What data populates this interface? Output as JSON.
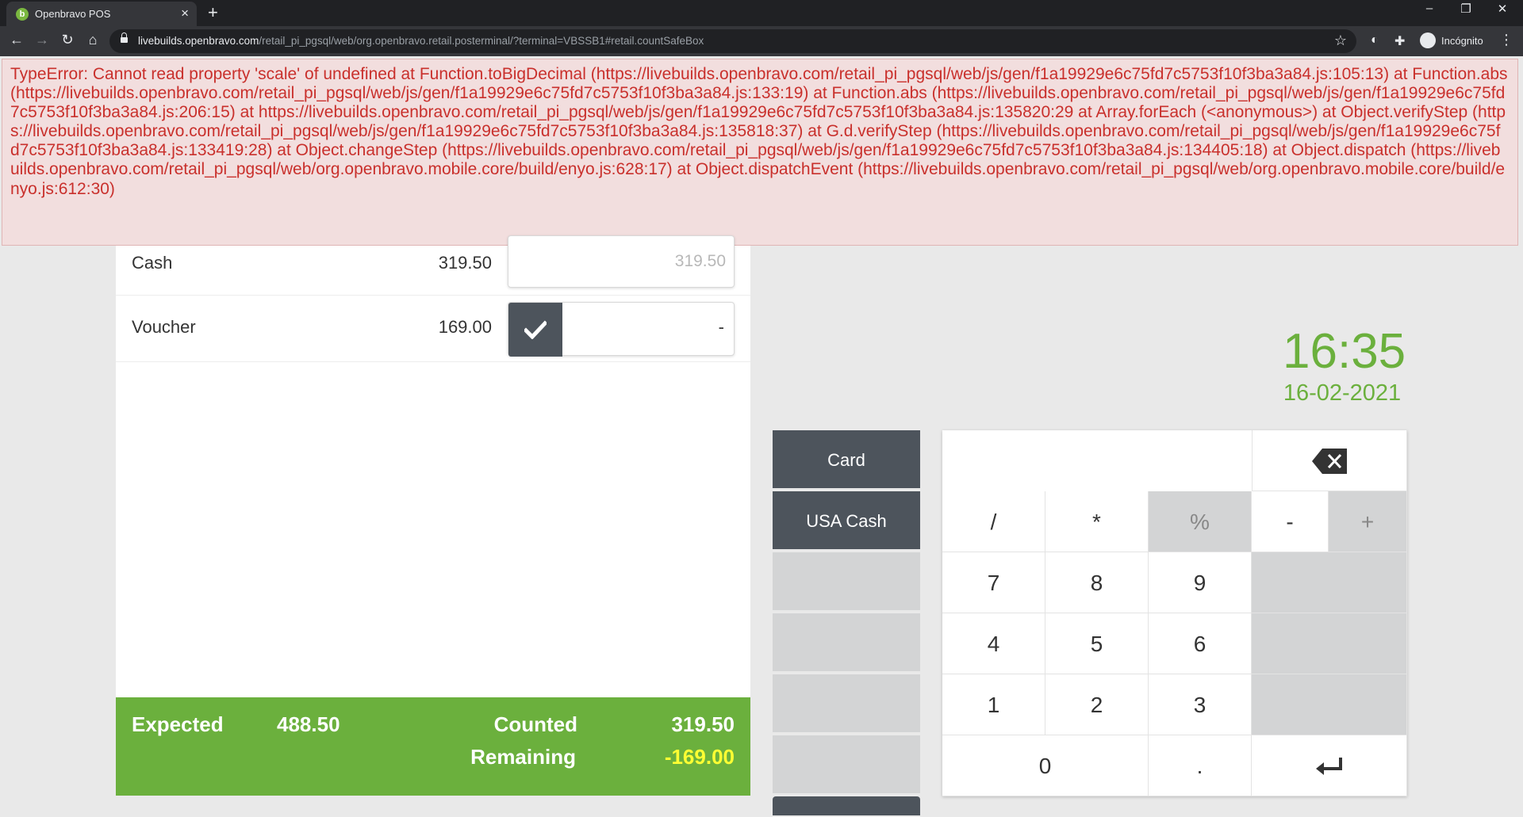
{
  "browser": {
    "tab_title": "Openbravo POS",
    "tab_favicon": "b",
    "new_tab": "+",
    "url_host": "livebuilds.openbravo.com",
    "url_path": "/retail_pi_pgsql/web/org.openbravo.retail.posterminal/?terminal=VBSSB1#retail.countSafeBox",
    "profile_label": "Incógnito"
  },
  "error": {
    "message": "TypeError: Cannot read property 'scale' of undefined at Function.toBigDecimal (https://livebuilds.openbravo.com/retail_pi_pgsql/web/js/gen/f1a19929e6c75fd7c5753f10f3ba3a84.js:105:13) at Function.abs (https://livebuilds.openbravo.com/retail_pi_pgsql/web/js/gen/f1a19929e6c75fd7c5753f10f3ba3a84.js:133:19) at Function.abs (https://livebuilds.openbravo.com/retail_pi_pgsql/web/js/gen/f1a19929e6c75fd7c5753f10f3ba3a84.js:206:15) at https://livebuilds.openbravo.com/retail_pi_pgsql/web/js/gen/f1a19929e6c75fd7c5753f10f3ba3a84.js:135820:29 at Array.forEach (<anonymous>) at Object.verifyStep (https://livebuilds.openbravo.com/retail_pi_pgsql/web/js/gen/f1a19929e6c75fd7c5753f10f3ba3a84.js:135818:37) at G.d.verifyStep (https://livebuilds.openbravo.com/retail_pi_pgsql/web/js/gen/f1a19929e6c75fd7c5753f10f3ba3a84.js:133419:28) at Object.changeStep (https://livebuilds.openbravo.com/retail_pi_pgsql/web/js/gen/f1a19929e6c75fd7c5753f10f3ba3a84.js:134405:18) at Object.dispatch (https://livebuilds.openbravo.com/retail_pi_pgsql/web/org.openbravo.mobile.core/build/enyo.js:628:17) at Object.dispatchEvent (https://livebuilds.openbravo.com/retail_pi_pgsql/web/org.openbravo.mobile.core/build/enyo.js:612:30)"
  },
  "payments": [
    {
      "name": "Cash",
      "expected": "319.50",
      "counted_placeholder": "319.50"
    },
    {
      "name": "Voucher",
      "expected": "169.00",
      "counted_value": "-"
    }
  ],
  "totals": {
    "expected_label": "Expected",
    "expected_value": "488.50",
    "counted_label": "Counted",
    "counted_value": "319.50",
    "remaining_label": "Remaining",
    "remaining_value": "-169.00"
  },
  "clock": {
    "time": "16:35",
    "date": "16-02-2021"
  },
  "side_buttons": [
    "Card",
    "USA Cash"
  ],
  "keypad": {
    "row1": [
      "/",
      "*",
      "%",
      "-",
      "+"
    ],
    "row2": [
      "7",
      "8",
      "9"
    ],
    "row3": [
      "4",
      "5",
      "6"
    ],
    "row4": [
      "1",
      "2",
      "3"
    ],
    "row5": [
      "0",
      "."
    ]
  }
}
